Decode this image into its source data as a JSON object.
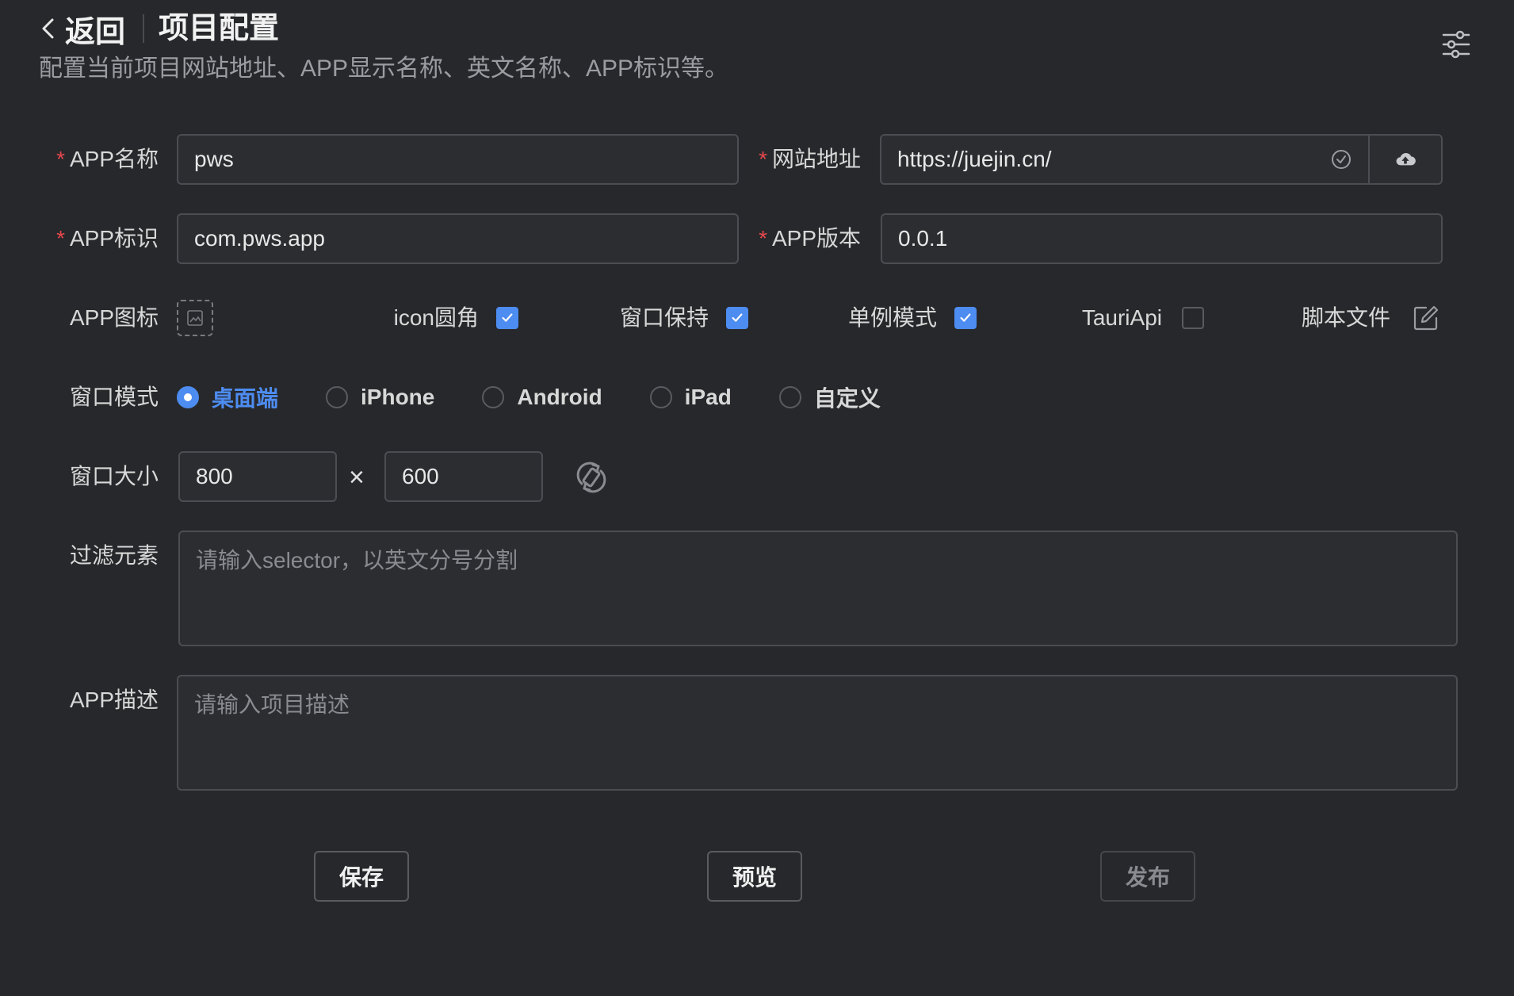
{
  "header": {
    "back_label": "返回",
    "title": "项目配置",
    "description": "配置当前项目网站地址、APP显示名称、英文名称、APP标识等。"
  },
  "form": {
    "required_mark": "*",
    "app_name": {
      "label": "APP名称",
      "value": "pws"
    },
    "website": {
      "label": "网站地址",
      "value": "https://juejin.cn/"
    },
    "app_id": {
      "label": "APP标识",
      "value": "com.pws.app"
    },
    "app_version": {
      "label": "APP版本",
      "value": "0.0.1"
    },
    "app_icon": {
      "label": "APP图标"
    },
    "options": [
      {
        "label": "icon圆角",
        "checked": true
      },
      {
        "label": "窗口保持",
        "checked": true
      },
      {
        "label": "单例模式",
        "checked": true
      },
      {
        "label": "TauriApi",
        "checked": false
      }
    ],
    "script_file": {
      "label": "脚本文件"
    },
    "window_mode": {
      "label": "窗口模式",
      "selected": "桌面端",
      "options": [
        "桌面端",
        "iPhone",
        "Android",
        "iPad",
        "自定义"
      ]
    },
    "window_size": {
      "label": "窗口大小",
      "width": "800",
      "height": "600",
      "separator": "×"
    },
    "filter": {
      "label": "过滤元素",
      "placeholder": "请输入selector，以英文分号分割"
    },
    "description": {
      "label": "APP描述",
      "placeholder": "请输入项目描述"
    }
  },
  "actions": {
    "save": "保存",
    "preview": "预览",
    "publish": "发布"
  },
  "colors": {
    "accent": "#4d8cf0",
    "required": "#e5484d",
    "background": "#27282b"
  }
}
